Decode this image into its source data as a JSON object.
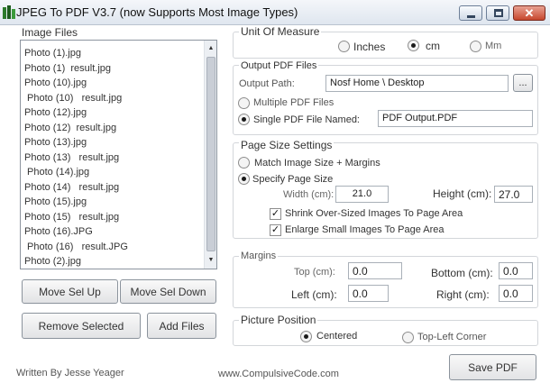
{
  "window": {
    "title": "JPEG To PDF V3.7 (now Supports Most Image Types)",
    "close_glyph": "✕"
  },
  "image_files": {
    "legend": "Image Files",
    "items": [
      "Photo (1).jpg",
      "Photo (1)  result.jpg",
      "Photo (10).jpg",
      " Photo (10)   result.jpg",
      "Photo (12).jpg",
      "Photo (12)  result.jpg",
      "Photo (13).jpg",
      "Photo (13)   result.jpg",
      " Photo (14).jpg",
      "Photo (14)   result.jpg",
      "Photo (15).jpg",
      "Photo (15)   result.jpg",
      "Photo (16).JPG",
      " Photo (16)   result.JPG",
      "Photo (2).jpg"
    ],
    "scroll_up": "▲",
    "scroll_down": "▼",
    "buttons": {
      "move_up": "Move Sel Up",
      "move_down": "Move Sel Down",
      "remove": "Remove Selected",
      "add": "Add Files"
    }
  },
  "unit_of_measure": {
    "legend": "Unit Of Measure",
    "options": [
      "Inches",
      "cm",
      "Mm"
    ],
    "selected": "cm"
  },
  "output": {
    "legend": "Output PDF Files",
    "path_label": "Output Path:",
    "path_value": "Nosf Home \\ Desktop",
    "browse_label": "...",
    "multiple_label": "Multiple PDF Files",
    "single_label": "Single PDF File Named:",
    "single_value": "PDF  Output.PDF",
    "mode": "single"
  },
  "page_size": {
    "legend": "Page Size Settings",
    "match_label": "Match Image Size + Margins",
    "specify_label": "Specify Page Size",
    "mode": "specify",
    "width_label": "Width (cm):",
    "width_value": "21.0",
    "height_label": "Height (cm):",
    "height_value": "27.0",
    "shrink_label": "Shrink Over-Sized Images To Page Area",
    "shrink_checked": true,
    "enlarge_label": "Enlarge Small Images To Page Area",
    "enlarge_checked": true,
    "check_glyph": "✓"
  },
  "margins": {
    "legend": "Margins",
    "top_label": "Top (cm):",
    "top_value": "0.0",
    "bottom_label": "Bottom (cm):",
    "bottom_value": "0.0",
    "left_label": "Left (cm):",
    "left_value": "0.0",
    "right_label": "Right (cm):",
    "right_value": "0.0"
  },
  "picture_position": {
    "legend": "Picture Position",
    "options": [
      "Centered",
      "Top-Left Corner"
    ],
    "selected": "Centered"
  },
  "footer": {
    "author": "Written By Jesse Yeager",
    "website": "www.CompulsiveCode.com",
    "save_label": "Save PDF"
  }
}
